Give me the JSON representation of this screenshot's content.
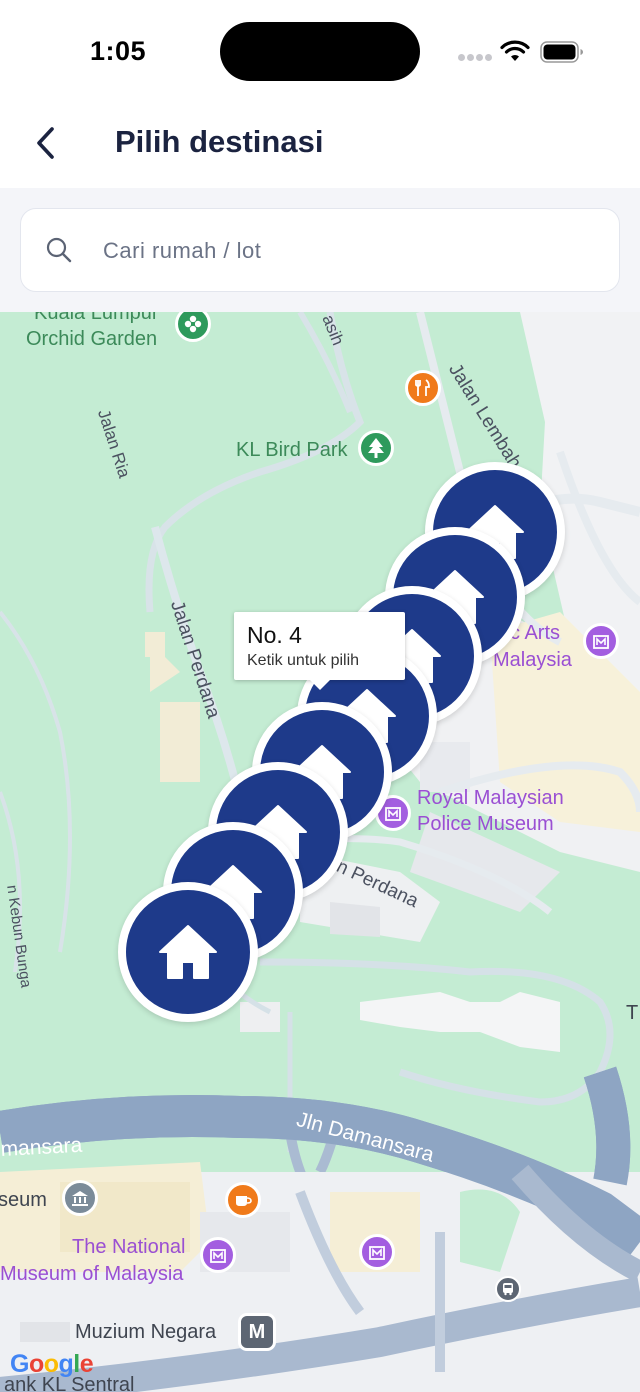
{
  "status_bar": {
    "time": "1:05"
  },
  "header": {
    "title": "Pilih destinasi",
    "back_icon": "chevron-left-icon"
  },
  "search": {
    "placeholder": "Cari rumah / lot",
    "value": ""
  },
  "map": {
    "tooltip": {
      "title": "No. 4",
      "subtitle": "Ketik untuk pilih"
    },
    "house_markers": [
      "house-1",
      "house-2",
      "house-3",
      "house-4",
      "house-5",
      "house-6",
      "house-7"
    ],
    "labels": {
      "orchid_garden_1": "Kuala Lumpur",
      "orchid_garden_2": "Orchid Garden",
      "bird_park": "KL Bird Park",
      "islamic_arts_1": "c Arts",
      "islamic_arts_2": "Malaysia",
      "police_museum_1": "Royal Malaysian",
      "police_museum_2": "Police Museum",
      "national_museum_1": "The National",
      "national_museum_2": "Museum of Malaysia",
      "museum_left": "seum",
      "muzium_negara": "Muzium Negara",
      "kl_sentral": "ank KL Sentral",
      "edge_t": "T"
    },
    "roads": {
      "jalan_lembah": "Jalan Lembah",
      "jalan_ria": "Jalan Ria",
      "jalan_perdana": "Jalan Perdana",
      "jalan_perdana_2": "n Perdana",
      "jalan_kebun_bunga": "n Kebun Bunga",
      "asih": "asih",
      "jln_damansara": "Jln Damansara",
      "damansara_left": "mansara"
    },
    "metro_badge": "M",
    "attribution": [
      "G",
      "o",
      "o",
      "g",
      "l",
      "e"
    ],
    "colors": {
      "park": "#c4ecd3",
      "marker": "#1e3a8a",
      "road_major": "#8ea5c3",
      "road_minor": "#ffffff",
      "purple_poi": "#a35ee0",
      "orange_poi": "#f07a1a",
      "green_poi": "#2e9a5c"
    }
  }
}
